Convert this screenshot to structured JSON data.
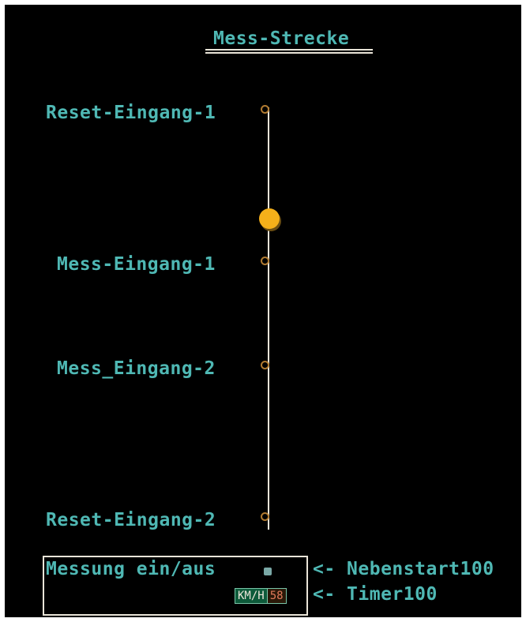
{
  "title": "Mess-Strecke",
  "labels": {
    "reset_1": "Reset-Eingang-1",
    "mess_1": "Mess-Eingang-1",
    "mess_2": "Mess_Eingang-2",
    "reset_2": "Reset-Eingang-2"
  },
  "panel": {
    "measure_label": "Messung ein/aus",
    "speed_unit": "KM/H",
    "speed_value": "58"
  },
  "refs": {
    "nebenstart": "<- Nebenstart100",
    "timer": "<- Timer100"
  },
  "colors": {
    "background": "#000000",
    "text": "#4fb8b4",
    "track": "#e9e4d8",
    "ball": "#f5b01a",
    "sensor": "#b07a30"
  }
}
